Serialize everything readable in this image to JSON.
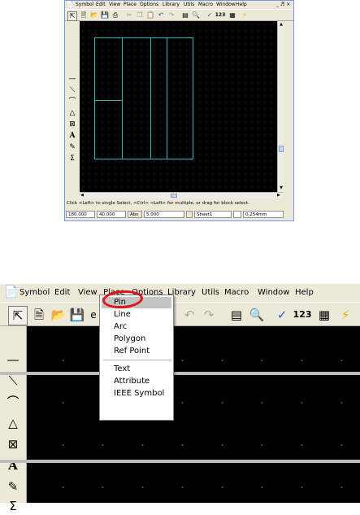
{
  "thumbnail": {
    "window_controls": "_ ♬ ×",
    "menu": [
      "Symbol",
      "Edit",
      "View",
      "Place",
      "Options",
      "Library",
      "Utils",
      "Macro",
      "Window",
      "Help"
    ],
    "toolbar_count_label": "123",
    "status_message": "Click <Left> to single Select, <Ctrl> <Left> for multiple, or drag for block select.",
    "status": {
      "x_coord": "180.000",
      "y_coord": "40.000",
      "abs_label": "Abs",
      "grid_value": "5.000",
      "sheet": "Sheet1",
      "line_width": "0.254mm"
    }
  },
  "zoomed": {
    "menu": [
      "Symbol",
      "Edit",
      "View",
      "Place",
      "Options",
      "Library",
      "Utils",
      "Macro",
      "Window",
      "Help"
    ],
    "toolbar_count_label": "123",
    "toolbar_partial_label": "e",
    "place_menu": {
      "items": [
        "Pin",
        "Line",
        "Arc",
        "Polygon",
        "Ref Point"
      ],
      "items2": [
        "Text",
        "Attribute",
        "IEEE Symbol"
      ],
      "highlighted": "Pin"
    }
  },
  "colors": {
    "canvas_bg": "#000000",
    "outline": "#2fb7b7",
    "highlight_circle": "#e0141a"
  }
}
